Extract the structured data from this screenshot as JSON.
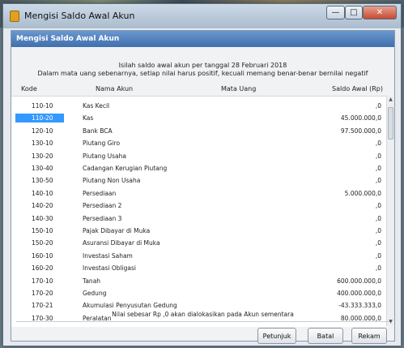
{
  "window": {
    "title": "Mengisi Saldo Awal Akun"
  },
  "panel": {
    "header": "Mengisi Saldo Awal Akun",
    "info_line1": "Isilah saldo awal akun per tanggal 28 Februari 2018",
    "info_line2": "Dalam mata uang sebenarnya, setiap nilai harus positif, kecuali memang benar-benar bernilai negatif"
  },
  "table": {
    "columns": {
      "kode": "Kode",
      "nama": "Nama Akun",
      "mata_uang": "Mata Uang",
      "saldo": "Saldo Awal (Rp)"
    },
    "rows": [
      {
        "kode": "110-10",
        "nama": "Kas Kecil",
        "saldo": ",0"
      },
      {
        "kode": "110-20",
        "nama": "Kas",
        "saldo": "45.000.000,0"
      },
      {
        "kode": "120-10",
        "nama": "Bank BCA",
        "saldo": "97.500.000,0"
      },
      {
        "kode": "130-10",
        "nama": "Piutang Giro",
        "saldo": ",0"
      },
      {
        "kode": "130-20",
        "nama": "Piutang Usaha",
        "saldo": ",0"
      },
      {
        "kode": "130-40",
        "nama": "Cadangan Kerugian Piutang",
        "saldo": ",0"
      },
      {
        "kode": "130-50",
        "nama": "Piutang Non Usaha",
        "saldo": ",0"
      },
      {
        "kode": "140-10",
        "nama": "Persediaan",
        "saldo": "5.000.000,0"
      },
      {
        "kode": "140-20",
        "nama": "Persediaan 2",
        "saldo": ",0"
      },
      {
        "kode": "140-30",
        "nama": "Persediaan 3",
        "saldo": ",0"
      },
      {
        "kode": "150-10",
        "nama": "Pajak Dibayar di Muka",
        "saldo": ",0"
      },
      {
        "kode": "150-20",
        "nama": "Asuransi Dibayar di Muka",
        "saldo": ",0"
      },
      {
        "kode": "160-10",
        "nama": "Investasi Saham",
        "saldo": ",0"
      },
      {
        "kode": "160-20",
        "nama": "Investasi Obligasi",
        "saldo": ",0"
      },
      {
        "kode": "170-10",
        "nama": "Tanah",
        "saldo": "600.000.000,0"
      },
      {
        "kode": "170-20",
        "nama": "Gedung",
        "saldo": "400.000.000,0"
      },
      {
        "kode": "170-21",
        "nama": "Akumulasi Penyusutan Gedung",
        "saldo": "-43.333.333,0"
      },
      {
        "kode": "170-30",
        "nama": "Peralatan",
        "saldo": "80.000.000,0"
      }
    ],
    "selected_row": "110-20"
  },
  "footnote": "Nilai sebesar Rp ,0 akan dialokasikan pada Akun sementara",
  "buttons": {
    "petunjuk": "Petunjuk",
    "batal": "Batal",
    "rekam": "Rekam"
  },
  "colors": {
    "header": "#4a7bbd",
    "selection": "#3399ff"
  }
}
